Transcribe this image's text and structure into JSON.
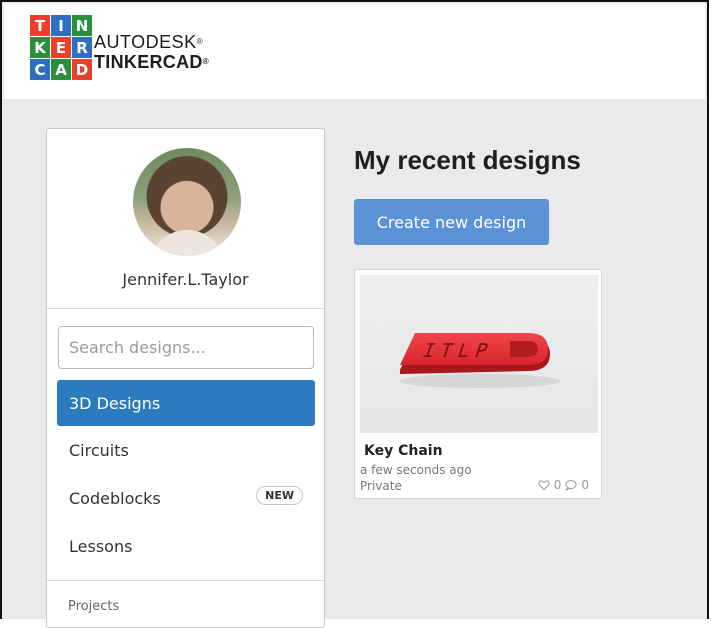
{
  "brand": {
    "logo_letters": [
      "T",
      "I",
      "N",
      "K",
      "E",
      "R",
      "C",
      "A",
      "D"
    ],
    "logo_colors": [
      "#e8402b",
      "#2e6fc2",
      "#2a8f3c",
      "#2a8f3c",
      "#e8402b",
      "#2e6fc2",
      "#2e6fc2",
      "#2a8f3c",
      "#e8402b"
    ],
    "line1": "AUTODESK",
    "line2": "TINKERCAD"
  },
  "sidebar": {
    "username": "Jennifer.L.Taylor",
    "search_placeholder": "Search designs...",
    "items": [
      {
        "label": "3D Designs",
        "active": true
      },
      {
        "label": "Circuits"
      },
      {
        "label": "Codeblocks",
        "badge": "NEW"
      },
      {
        "label": "Lessons"
      }
    ],
    "section_label": "Projects"
  },
  "main": {
    "title": "My recent designs",
    "create_button": "Create new design",
    "designs": [
      {
        "title": "Key Chain",
        "updated": "a few seconds ago",
        "privacy": "Private",
        "likes": "0",
        "comments": "0",
        "thumb_text": "ITLP"
      }
    ]
  },
  "colors": {
    "active_nav": "#2d7bbf",
    "create_button": "#5b93d6",
    "keychain_red": "#d8262b"
  }
}
